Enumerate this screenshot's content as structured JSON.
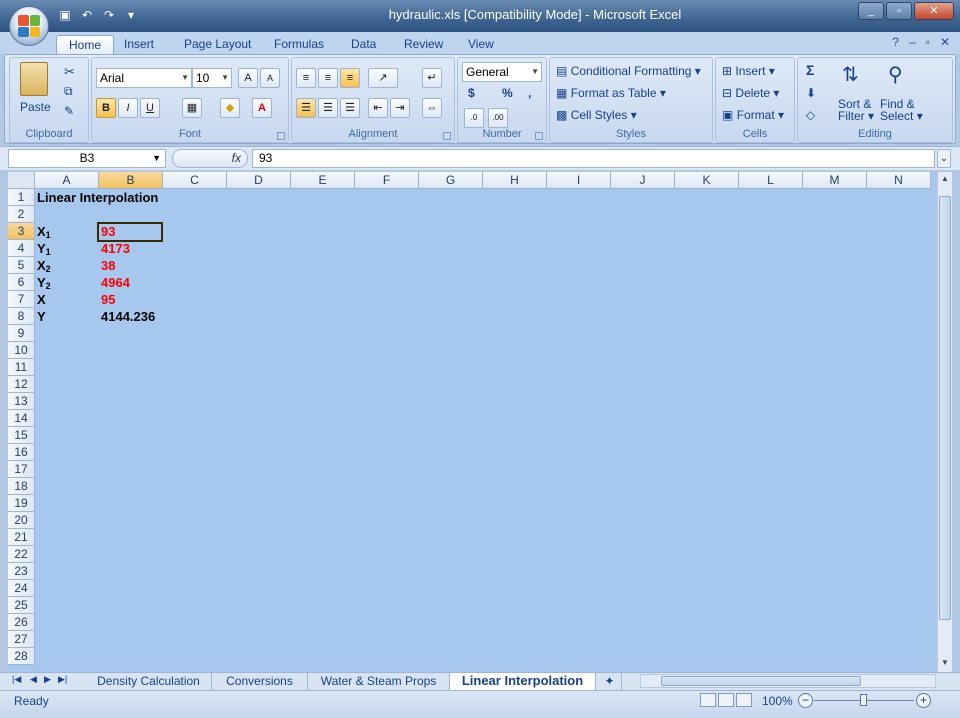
{
  "window": {
    "title": "hydraulic.xls  [Compatibility Mode] - Microsoft Excel",
    "controls": [
      "minimize",
      "restore",
      "close"
    ],
    "controls_glyphs": [
      "_",
      "▫",
      "✕"
    ]
  },
  "quick_access": {
    "icons": [
      "save-icon",
      "undo-icon",
      "redo-icon",
      "customize-icon"
    ],
    "glyphs": [
      "▣",
      "↶",
      "↷",
      "▾"
    ]
  },
  "ribbon_tabs": [
    "Home",
    "Insert",
    "Page Layout",
    "Formulas",
    "Data",
    "Review",
    "View"
  ],
  "active_tab": "Home",
  "ribbon": {
    "clipboard": {
      "label": "Clipboard",
      "paste": "Paste"
    },
    "font": {
      "label": "Font",
      "font_name": "Arial",
      "font_size": "10",
      "bold": "B",
      "italic": "I",
      "underline": "U",
      "grow": "A",
      "shrink": "A"
    },
    "alignment": {
      "label": "Alignment"
    },
    "number": {
      "label": "Number",
      "format": "General",
      "currency": "$",
      "percent": "%",
      "comma": ","
    },
    "styles": {
      "label": "Styles",
      "conditional": "Conditional Formatting",
      "format_table": "Format as Table",
      "cell_styles": "Cell Styles"
    },
    "cells": {
      "label": "Cells",
      "insert": "Insert",
      "delete": "Delete",
      "format": "Format"
    },
    "editing": {
      "label": "Editing",
      "sum": "Σ",
      "sort": "Sort &",
      "filter": "Filter",
      "find": "Find &",
      "select": "Select"
    }
  },
  "formula_bar": {
    "name_box": "B3",
    "fx": "fx",
    "value": "93"
  },
  "columns": [
    "A",
    "B",
    "C",
    "D",
    "E",
    "F",
    "G",
    "H",
    "I",
    "J",
    "K",
    "L",
    "M",
    "N"
  ],
  "rows": [
    "1",
    "2",
    "3",
    "4",
    "5",
    "6",
    "7",
    "8",
    "9",
    "10",
    "11",
    "12",
    "13",
    "14",
    "15",
    "16",
    "17",
    "18",
    "19",
    "20",
    "21",
    "22",
    "23",
    "24",
    "25",
    "26",
    "27",
    "28"
  ],
  "selected_cell": "B3",
  "cells": {
    "a1": "Linear Interpolation",
    "a3": "X",
    "a3_sub": "1",
    "a4": "Y",
    "a4_sub": "1",
    "a5": "X",
    "a5_sub": "2",
    "a6": "Y",
    "a6_sub": "2",
    "a7": "X",
    "a8": "Y",
    "b3": "93",
    "b4": "4173",
    "b5": "38",
    "b6": "4964",
    "b7": "95",
    "b8": "4144.236"
  },
  "colors": {
    "input_red": "#ff0000",
    "sheet_bg": "#a6c8ee",
    "selection": "#3a2a00"
  },
  "sheet_tabs": [
    "Density Calculation",
    "Conversions",
    "Water & Steam Props",
    "Linear Interpolation"
  ],
  "active_sheet": "Linear Interpolation",
  "status": {
    "text": "Ready",
    "zoom": "100%",
    "zoom_out": "−",
    "zoom_in": "+"
  }
}
